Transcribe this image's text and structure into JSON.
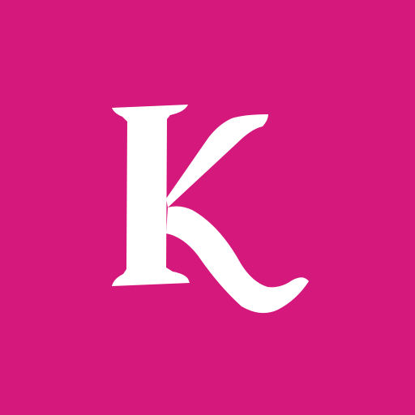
{
  "icon": {
    "logo_letter": "K",
    "background_color": "#D5197C",
    "glyph_color": "#FFFFFF"
  }
}
